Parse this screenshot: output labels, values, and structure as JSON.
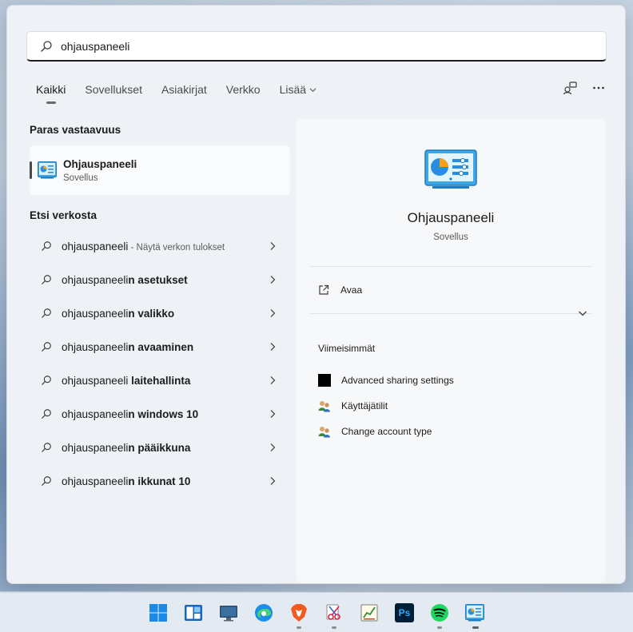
{
  "search": {
    "value": "ohjauspaneeli",
    "icon": "search-icon"
  },
  "tabs": [
    {
      "label": "Kaikki",
      "active": true
    },
    {
      "label": "Sovellukset"
    },
    {
      "label": "Asiakirjat"
    },
    {
      "label": "Verkko"
    },
    {
      "label": "Lisää",
      "has_dropdown": true
    }
  ],
  "best_match": {
    "heading": "Paras vastaavuus",
    "title": "Ohjauspaneeli",
    "subtitle": "Sovellus"
  },
  "web": {
    "heading": "Etsi verkosta",
    "items": [
      {
        "base": "ohjauspaneeli",
        "suffix": "",
        "hint": " - Näytä verkon tulokset"
      },
      {
        "base": "ohjauspaneeli",
        "suffix": "n asetukset",
        "hint": ""
      },
      {
        "base": "ohjauspaneeli",
        "suffix": "n valikko",
        "hint": ""
      },
      {
        "base": "ohjauspaneeli",
        "suffix": "n avaaminen",
        "hint": ""
      },
      {
        "base": "ohjauspaneeli",
        "suffix": " laitehallinta",
        "hint": ""
      },
      {
        "base": "ohjauspaneeli",
        "suffix": "n windows 10",
        "hint": ""
      },
      {
        "base": "ohjauspaneeli",
        "suffix": "n pääikkuna",
        "hint": ""
      },
      {
        "base": "ohjauspaneeli",
        "suffix": "n ikkunat 10",
        "hint": ""
      }
    ]
  },
  "preview": {
    "title": "Ohjauspaneeli",
    "subtitle": "Sovellus",
    "open_label": "Avaa",
    "recent_heading": "Viimeisimmät",
    "recent": [
      {
        "label": "Advanced sharing settings",
        "icon": "black-square-icon"
      },
      {
        "label": "Käyttäjätilit",
        "icon": "user-accounts-icon"
      },
      {
        "label": "Change account type",
        "icon": "user-accounts-icon"
      }
    ]
  },
  "taskbar": {
    "icons": [
      "windows-start-icon",
      "widgets-icon",
      "desktop-icon",
      "edge-icon",
      "brave-icon",
      "snipping-icon",
      "notepad-chart-icon",
      "photoshop-icon",
      "spotify-icon",
      "control-panel-icon"
    ],
    "photoshop_label": "Ps"
  },
  "colors": {
    "panel_bg": "#eef1f6",
    "preview_bg": "#f7f8fa",
    "accent": "#1f1f1f"
  }
}
